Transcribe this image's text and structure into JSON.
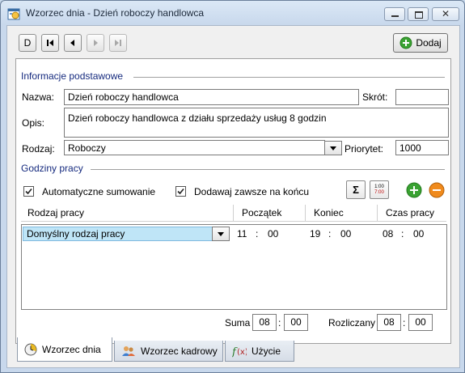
{
  "window": {
    "title": "Wzorzec dnia - Dzień roboczy handlowca"
  },
  "toolbar": {
    "add_label": "Dodaj",
    "first_label": "D"
  },
  "basic": {
    "section": "Informacje podstawowe",
    "name_label": "Nazwa:",
    "name_value": "Dzień roboczy handlowca",
    "short_label": "Skrót:",
    "short_value": "",
    "desc_label": "Opis:",
    "desc_value": "Dzień roboczy handlowca z działu sprzedaży usług 8 godzin",
    "type_label": "Rodzaj:",
    "type_value": "Roboczy",
    "priority_label": "Priorytet:",
    "priority_value": "1000"
  },
  "hours": {
    "section": "Godziny pracy",
    "auto_sum_label": "Automatyczne sumowanie",
    "auto_sum_checked": true,
    "append_label": "Dodawaj zawsze na końcu",
    "append_checked": true,
    "sum_icon_text": "Σ",
    "time_icon_top": "1:00",
    "time_icon_bottom": "7:00"
  },
  "table": {
    "headers": [
      "Rodzaj pracy",
      "Początek",
      "Koniec",
      "Czas pracy"
    ],
    "rows": [
      {
        "type": "Domyślny rodzaj pracy",
        "start_h": "11",
        "start_m": "00",
        "end_h": "19",
        "end_m": "00",
        "dur_h": "08",
        "dur_m": "00"
      }
    ],
    "sep": ":"
  },
  "footer": {
    "sum_label": "Suma",
    "sum_h": "08",
    "sum_m": "00",
    "calc_label": "Rozliczany",
    "calc_h": "08",
    "calc_m": "00",
    "sep": ":"
  },
  "tabs": [
    {
      "label": "Wzorzec dnia"
    },
    {
      "label": "Wzorzec kadrowy"
    },
    {
      "label": "Użycie"
    }
  ],
  "colors": {
    "section": "#152a7e",
    "selection": "#bfe5f7"
  }
}
